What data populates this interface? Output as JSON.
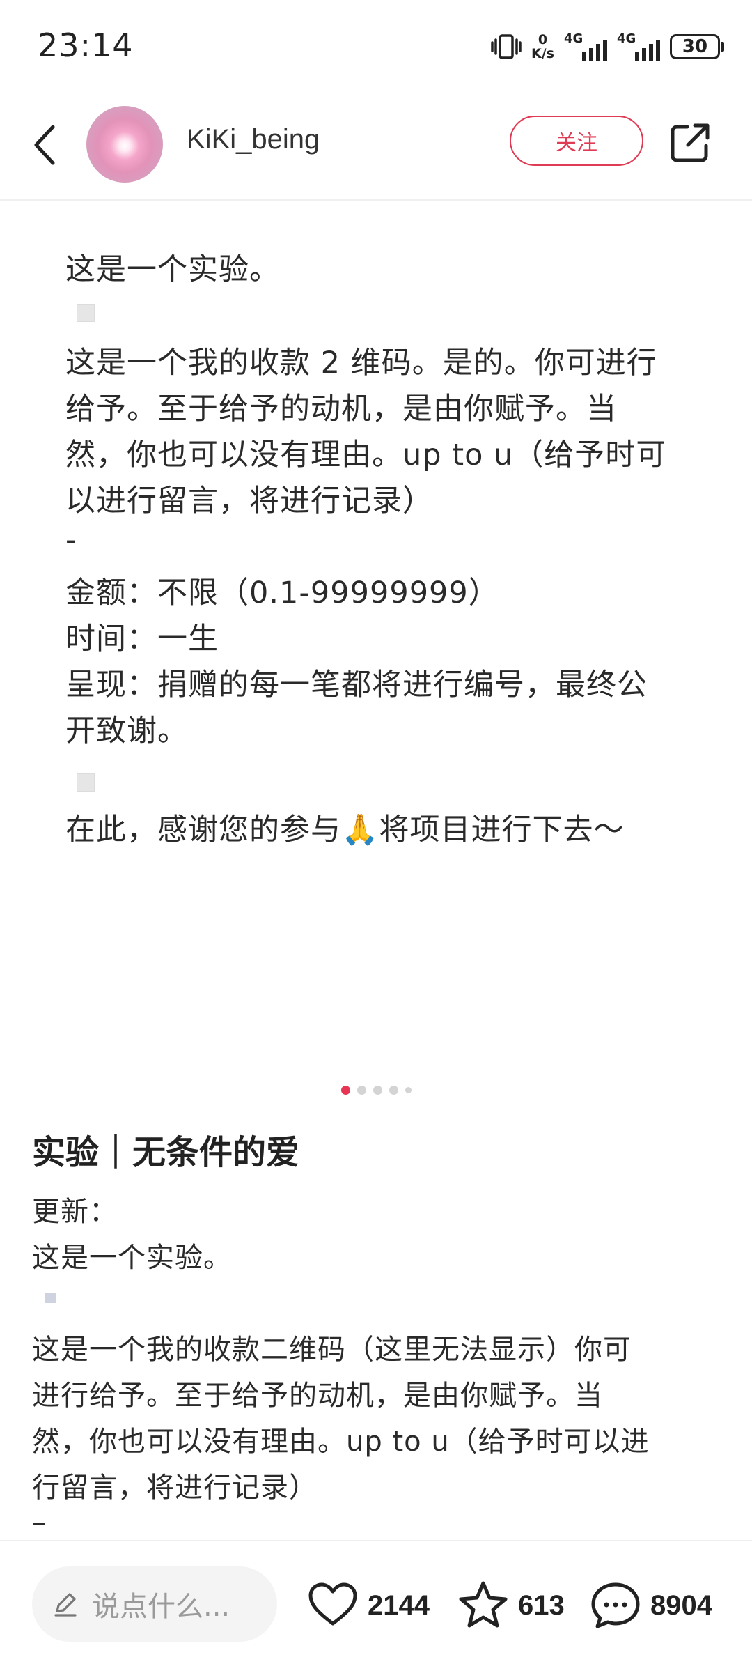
{
  "status_bar": {
    "time": "23:14",
    "net_speed_value": "0",
    "net_speed_unit": "K/s",
    "network_1": "4G",
    "network_2": "4G",
    "battery": "30"
  },
  "header": {
    "username": "KiKi_being",
    "follow_label": "关注"
  },
  "slide": {
    "lines": [
      "这是一个实验。",
      "这是一个我的收款 2 维码。是的。你可进行",
      "给予。至于给予的动机，是由你赋予。当",
      "然，你也可以没有理由。up to u（给予时可",
      "以进行留言，将进行记录）",
      "-",
      "金额：不限（0.1-99999999）",
      "时间：一生",
      "呈现：捐赠的每一笔都将进行编号，最终公",
      "开致谢。",
      "在此，感谢您的参与🙏将项目进行下去～"
    ],
    "page_count": 5,
    "active_page": 1
  },
  "post": {
    "title": "实验｜无条件的爱",
    "lines": [
      "更新：",
      "这是一个实验。",
      "这是一个我的收款二维码（这里无法显示）你可",
      "进行给予。至于给予的动机，是由你赋予。当",
      "然，你也可以没有理由。up to u（给予时可以进",
      "行留言，将进行记录）",
      "–"
    ]
  },
  "bottom_bar": {
    "comment_placeholder": "说点什么...",
    "likes": "2144",
    "favorites": "613",
    "comments": "8904"
  },
  "colors": {
    "accent": "#e03b55",
    "active_dot": "#e83553",
    "text": "#222222"
  }
}
